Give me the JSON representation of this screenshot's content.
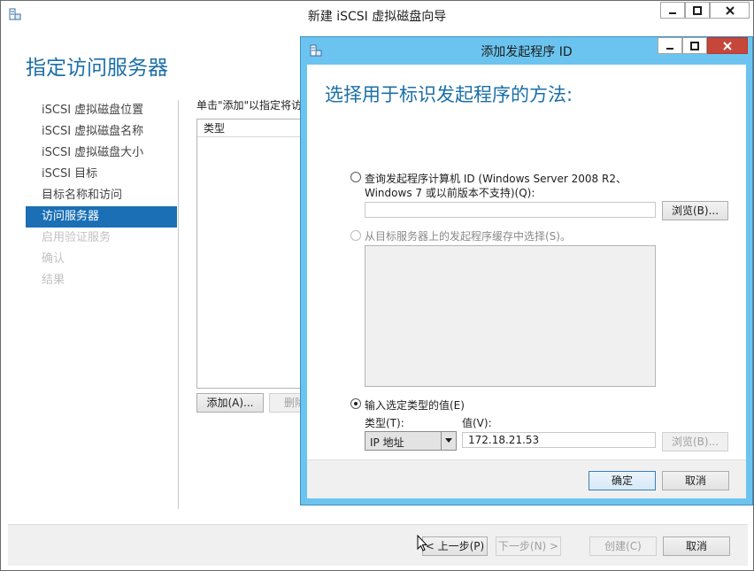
{
  "window": {
    "title": "新建 iSCSI 虚拟磁盘向导",
    "page_heading": "指定访问服务器",
    "instruction": "单击\"添加\"以指定将访",
    "list_header": "类型",
    "add_button": "添加(A)...",
    "remove_button": "删除",
    "nav": [
      {
        "label": "iSCSI 虚拟磁盘位置",
        "state": "normal"
      },
      {
        "label": "iSCSI 虚拟磁盘名称",
        "state": "normal"
      },
      {
        "label": "iSCSI 虚拟磁盘大小",
        "state": "normal"
      },
      {
        "label": "iSCSI 目标",
        "state": "normal"
      },
      {
        "label": "目标名称和访问",
        "state": "normal"
      },
      {
        "label": "访问服务器",
        "state": "active"
      },
      {
        "label": "启用验证服务",
        "state": "disabled"
      },
      {
        "label": "确认",
        "state": "disabled"
      },
      {
        "label": "结果",
        "state": "disabled"
      }
    ],
    "footer": {
      "prev": "< 上一步(P)",
      "next": "下一步(N) >",
      "create": "创建(C)",
      "cancel": "取消"
    }
  },
  "dialog": {
    "title": "添加发起程序 ID",
    "heading": "选择用于标识发起程序的方法:",
    "option1_line1": "查询发起程序计算机 ID (Windows Server 2008 R2、",
    "option1_line2": "Windows 7 或以前版本不支持)(Q):",
    "option1_value": "",
    "browse1": "浏览(B)...",
    "option2": "从目标服务器上的发起程序缓存中选择(S)。",
    "option3": "输入选定类型的值(E)",
    "type_label": "类型(T):",
    "value_label": "值(V):",
    "type_value": "IP 地址",
    "value_input": "172.18.21.53",
    "browse2": "浏览(B)...",
    "ok": "确定",
    "cancel": "取消",
    "selected_option": 3
  },
  "colors": {
    "accent": "#1a6fb5",
    "heading": "#1b6fa7",
    "dialog_frame": "#6bc4ef",
    "close_button": "#c7463a"
  }
}
